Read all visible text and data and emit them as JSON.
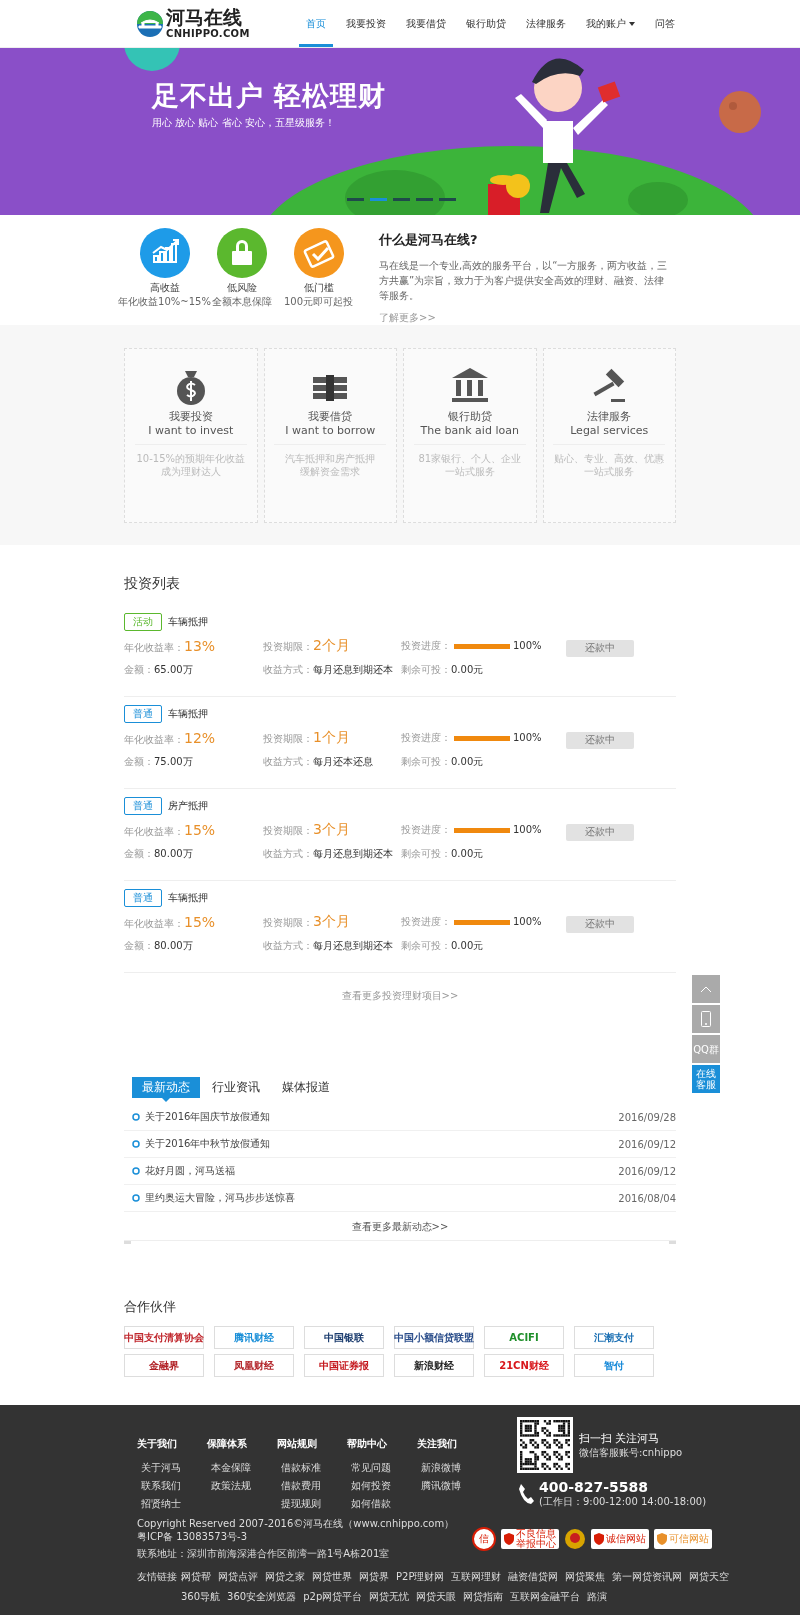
{
  "header": {
    "logo": {
      "name": "河马在线",
      "domain": "CNHIPPO.COM"
    },
    "nav": [
      {
        "label": "首页",
        "selected": true,
        "dropdown": false
      },
      {
        "label": "我要投资",
        "selected": false,
        "dropdown": false
      },
      {
        "label": "我要借贷",
        "selected": false,
        "dropdown": false
      },
      {
        "label": "银行助贷",
        "selected": false,
        "dropdown": false
      },
      {
        "label": "法律服务",
        "selected": false,
        "dropdown": false
      },
      {
        "label": "我的账户",
        "selected": false,
        "dropdown": true
      },
      {
        "label": "问答",
        "selected": false,
        "dropdown": false
      }
    ]
  },
  "banner": {
    "headline": "足不出户 轻松理财",
    "tagline": "用心 放心 贴心 省心 安心，五星级服务！",
    "slides": [
      {
        "selected": false
      },
      {
        "selected": true
      },
      {
        "selected": false
      },
      {
        "selected": false
      },
      {
        "selected": false
      }
    ]
  },
  "features": [
    {
      "kind": "growth",
      "title": "高收益",
      "caption": "年化收益10%~15%",
      "color": "#1e9be8"
    },
    {
      "kind": "lock",
      "title": "低风险",
      "caption": "全额本息保障",
      "color": "#5bb82e"
    },
    {
      "kind": "check",
      "title": "低门槛",
      "caption": "100元即可起投",
      "color": "#f5961d"
    }
  ],
  "about": {
    "title": "什么是河马在线?",
    "text": "马在线是一个专业,高效的服务平台，以“一方服务，两方收益，三方共赢”为宗旨，致力于为客户提供安全高效的理财、融资、法律等服务。",
    "more": "了解更多>>"
  },
  "services": [
    {
      "kind": "moneybag",
      "title": "我要投资",
      "subtitle": "I want to invest",
      "desc": [
        "10-15%的预期年化收益",
        "成为理财达人"
      ]
    },
    {
      "kind": "cash",
      "title": "我要借贷",
      "subtitle": "I want to borrow",
      "desc": [
        "汽车抵押和房产抵押",
        "缓解资金需求"
      ]
    },
    {
      "kind": "bank",
      "title": "银行助贷",
      "subtitle": "The bank aid loan",
      "desc": [
        "81家银行、个人、企业",
        "一站式服务"
      ]
    },
    {
      "kind": "gavel",
      "title": "法律服务",
      "subtitle": "Legal services",
      "desc": [
        "贴心、专业、高效、优惠",
        "一站式服务"
      ]
    }
  ],
  "investments": {
    "title": "投资列表",
    "more": "查看更多投资理财项目>>",
    "items": [
      {
        "tag": "活动",
        "kind": "activity",
        "name": "车辆抵押",
        "rate_label": "年化收益率：",
        "rate": "13%",
        "term_label": "投资期限：",
        "term": "2个月",
        "progress_label": "投资进度：",
        "level": 1,
        "progress": "100%",
        "button": "还款中",
        "disabled": true,
        "amount_label": "金额：",
        "amount": "65.00万",
        "method_label": "收益方式：",
        "method": "每月还息到期还本",
        "remaining_label": "剩余可投：",
        "remaining": "0.00元"
      },
      {
        "tag": "普通",
        "kind": "normal",
        "name": "车辆抵押",
        "rate_label": "年化收益率：",
        "rate": "12%",
        "term_label": "投资期限：",
        "term": "1个月",
        "progress_label": "投资进度：",
        "level": 1,
        "progress": "100%",
        "button": "还款中",
        "disabled": true,
        "amount_label": "金额：",
        "amount": "75.00万",
        "method_label": "收益方式：",
        "method": "每月还本还息",
        "remaining_label": "剩余可投：",
        "remaining": "0.00元"
      },
      {
        "tag": "普通",
        "kind": "normal",
        "name": "房产抵押",
        "rate_label": "年化收益率：",
        "rate": "15%",
        "term_label": "投资期限：",
        "term": "3个月",
        "progress_label": "投资进度：",
        "level": 1,
        "progress": "100%",
        "button": "还款中",
        "disabled": true,
        "amount_label": "金额：",
        "amount": "80.00万",
        "method_label": "收益方式：",
        "method": "每月还息到期还本",
        "remaining_label": "剩余可投：",
        "remaining": "0.00元"
      },
      {
        "tag": "普通",
        "kind": "normal",
        "name": "车辆抵押",
        "rate_label": "年化收益率：",
        "rate": "15%",
        "term_label": "投资期限：",
        "term": "3个月",
        "progress_label": "投资进度：",
        "level": 1,
        "progress": "100%",
        "button": "还款中",
        "disabled": true,
        "amount_label": "金额：",
        "amount": "80.00万",
        "method_label": "收益方式：",
        "method": "每月还息到期还本",
        "remaining_label": "剩余可投：",
        "remaining": "0.00元"
      }
    ]
  },
  "side_tools": [
    {
      "kind": "top"
    },
    {
      "kind": "phone"
    },
    {
      "kind": "text",
      "label": "QQ群"
    },
    {
      "kind": "highlight",
      "label": "在线客服"
    }
  ],
  "news": {
    "tabs": [
      {
        "label": "最新动态",
        "selected": true
      },
      {
        "label": "行业资讯",
        "selected": false
      },
      {
        "label": "媒体报道",
        "selected": false
      }
    ],
    "items": [
      {
        "title": "关于2016年国庆节放假通知",
        "date": "2016/09/28"
      },
      {
        "title": "关于2016年中秋节放假通知",
        "date": "2016/09/12"
      },
      {
        "title": "花好月圆，河马送福",
        "date": "2016/09/12"
      },
      {
        "title": "里约奥运大冒险，河马步步送惊喜",
        "date": "2016/08/04"
      }
    ],
    "more": "查看更多最新动态>>"
  },
  "partners": {
    "title": "合作伙伴",
    "logos": [
      {
        "name": "中国支付清算协会",
        "color": "#c0272d"
      },
      {
        "name": "腾讯财经",
        "color": "#1a8fd8"
      },
      {
        "name": "中国银联",
        "color": "#1b3c6e"
      },
      {
        "name": "中国小额信贷联盟",
        "color": "#2a4d8a"
      },
      {
        "name": "ACIFI",
        "color": "#1f8f2a"
      },
      {
        "name": "汇潮支付",
        "color": "#1a6fb3"
      },
      {
        "name": "金融界",
        "color": "#b01e23"
      },
      {
        "name": "凤凰财经",
        "color": "#b3262b"
      },
      {
        "name": "中国证券报",
        "color": "#c4161c"
      },
      {
        "name": "新浪财经",
        "color": "#222222"
      },
      {
        "name": "21CN财经",
        "color": "#d8161b"
      },
      {
        "name": "智付",
        "color": "#1488d8"
      }
    ]
  },
  "footer": {
    "columns": [
      {
        "title": "关于我们",
        "links": [
          "关于河马",
          "联系我们",
          "招贤纳士"
        ]
      },
      {
        "title": "保障体系",
        "links": [
          "本金保障",
          "政策法规"
        ]
      },
      {
        "title": "网站规则",
        "links": [
          "借款标准",
          "借款费用",
          "提现规则"
        ]
      },
      {
        "title": "帮助中心",
        "links": [
          "常见问题",
          "如何投资",
          "如何借款"
        ]
      },
      {
        "title": "关注我们",
        "links": [
          "新浪微博",
          "腾讯微博"
        ]
      }
    ],
    "qr": {
      "title": "扫一扫 关注河马",
      "subtitle": "微信客服账号:cnhippo"
    },
    "phone": {
      "number": "400-827-5588",
      "hours": "(工作日：9:00-12:00  14:00-18:00)"
    },
    "copyright": "Copyright Reserved 2007-2016©河马在线（www.cnhippo.com）粤ICP备 13083573号-3",
    "address": "联系地址：深圳市前海深港合作区前湾一路1号A栋201室",
    "badges": [
      {
        "kind": "seal",
        "label": "信",
        "color": "#d81e06"
      },
      {
        "kind": "label",
        "label": "不良信息举报中心",
        "color": "#d81e06"
      },
      {
        "kind": "emblem",
        "color": "#d8a400"
      },
      {
        "kind": "label",
        "label": "诚信网站",
        "color": "#d81e06"
      },
      {
        "kind": "label",
        "label": "可信网站",
        "color": "#e8902a"
      }
    ],
    "friend_links": {
      "label": "友情链接：",
      "links": [
        "网贷帮",
        "网贷点评",
        "网贷之家",
        "网贷世界",
        "网贷界",
        "P2P理财网",
        "互联网理财",
        "融资借贷网",
        "网贷聚焦",
        "第一网贷资讯网",
        "网贷天空",
        "360导航",
        "360安全浏览器",
        "p2p网贷平台",
        "网贷无忧",
        "网贷天眼",
        "网贷指南",
        "互联网金融平台",
        "路演"
      ]
    }
  }
}
